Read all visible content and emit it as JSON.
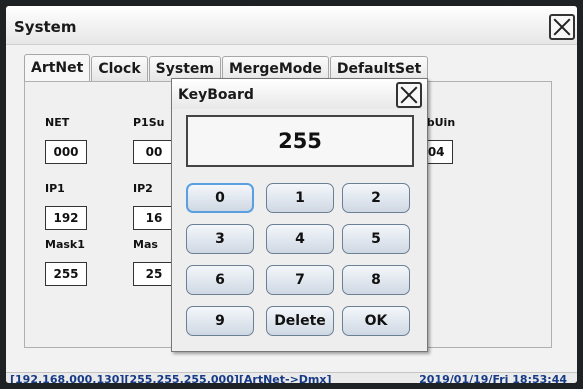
{
  "window": {
    "title": "System"
  },
  "tabs": [
    "ArtNet",
    "Clock",
    "System",
    "MergeMode",
    "DefaultSet"
  ],
  "fields": {
    "net": {
      "label": "NET",
      "value": "000"
    },
    "p1sub": {
      "label": "P1Su",
      "value": "00"
    },
    "subuin": {
      "label": "SubUin",
      "value": "004"
    },
    "ip1": {
      "label": "IP1",
      "value": "192"
    },
    "ip2": {
      "label": "IP2",
      "value": "16"
    },
    "mask1": {
      "label": "Mask1",
      "value": "255"
    },
    "mask2": {
      "label": "Mas",
      "value": "25"
    }
  },
  "keyboard": {
    "title": "KeyBoard",
    "display": "255",
    "keys": [
      "0",
      "1",
      "2",
      "3",
      "4",
      "5",
      "6",
      "7",
      "8",
      "9",
      "Delete",
      "OK"
    ]
  },
  "status": {
    "left": "[192.168.000.130][255.255.255.000][ArtNet->Dmx]",
    "right": "2019/01/19/Fri 18:53:44"
  }
}
